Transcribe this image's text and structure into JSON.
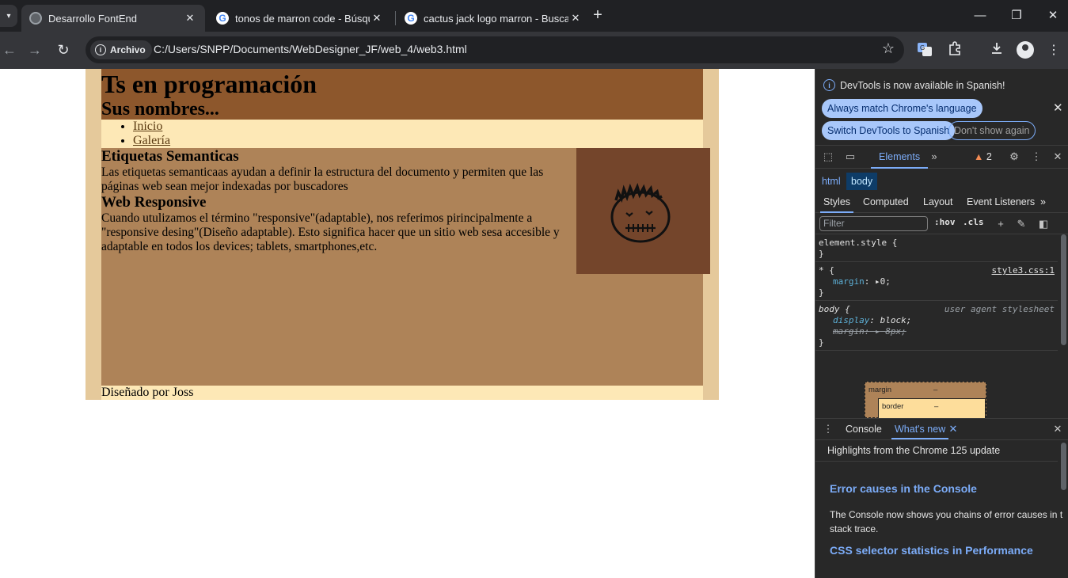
{
  "browser": {
    "tabs": [
      {
        "title": "Desarrollo FontEnd",
        "active": true,
        "favicon": "globe-icon"
      },
      {
        "title": "tonos de marron code - Búsqu",
        "active": false,
        "favicon": "google-icon"
      },
      {
        "title": "cactus jack logo marron - Busca",
        "active": false,
        "favicon": "google-icon"
      }
    ],
    "google_letter": "G",
    "new_tab": "+",
    "address": {
      "chip_label": "Archivo",
      "url": "C:/Users/SNPP/Documents/WebDesigner_JF/web_4/web3.html"
    }
  },
  "page": {
    "title": "Ts en programación",
    "subtitle": "Sus nombres...",
    "nav": [
      "Inicio",
      "Galería"
    ],
    "sections": [
      {
        "heading": "Etiquetas Semanticas",
        "text": "Las etiquetas semanticaas ayudan a definir la estructura del documento y permiten que las páginas web sean mejor indexadas por buscadores"
      },
      {
        "heading": "Web Responsive",
        "text": "Cuando utulizamos el término \"responsive\"(adaptable), nos referimos pirincipalmente a \"responsive desing\"(Diseño adaptable). Esto significa hacer que un sitio web sesa accesible y adaptable en todos los devices; tablets, smartphones,etc."
      }
    ],
    "footer": "Diseñado por Joss",
    "colors": {
      "outer": "#e5c99b",
      "header": "#8d572c",
      "nav": "#fde8b6",
      "main": "#ae8358",
      "image_bg": "#74452b"
    }
  },
  "devtools": {
    "infobar": {
      "message": "DevTools is now available in Spanish!",
      "btn_match": "Always match Chrome's language",
      "btn_switch": "Switch DevTools to Spanish",
      "btn_dismiss": "Don't show again"
    },
    "tabs": {
      "elements": "Elements",
      "more": "»",
      "warnings": "2"
    },
    "breadcrumbs": [
      "html",
      "body"
    ],
    "sub_tabs": [
      "Styles",
      "Computed",
      "Layout",
      "Event Listeners",
      "»"
    ],
    "filter_placeholder": "Filter",
    "hov": ":hov",
    "cls": ".cls",
    "rules": {
      "element_style": "element.style {",
      "close": "}",
      "universal_selector": "* {",
      "universal_source": "style3.css:1",
      "universal_prop": "margin",
      "universal_val": "0;",
      "body_selector": "body {",
      "body_source": "user agent stylesheet",
      "body_prop1": "display",
      "body_val1": "block;",
      "body_prop2": "margin",
      "body_val2": "8px;",
      "colon": ":"
    },
    "boxmodel": {
      "margin": "margin",
      "border": "border",
      "dash": "–"
    },
    "drawer": {
      "console": "Console",
      "whats_new": "What's new",
      "highlights": "Highlights from the Chrome 125 update",
      "item1_title": "Error causes in the Console",
      "item1_text": "The Console now shows you chains of error causes in t",
      "item1_text2": "stack trace.",
      "item2_title": "CSS selector statistics in Performance"
    }
  }
}
